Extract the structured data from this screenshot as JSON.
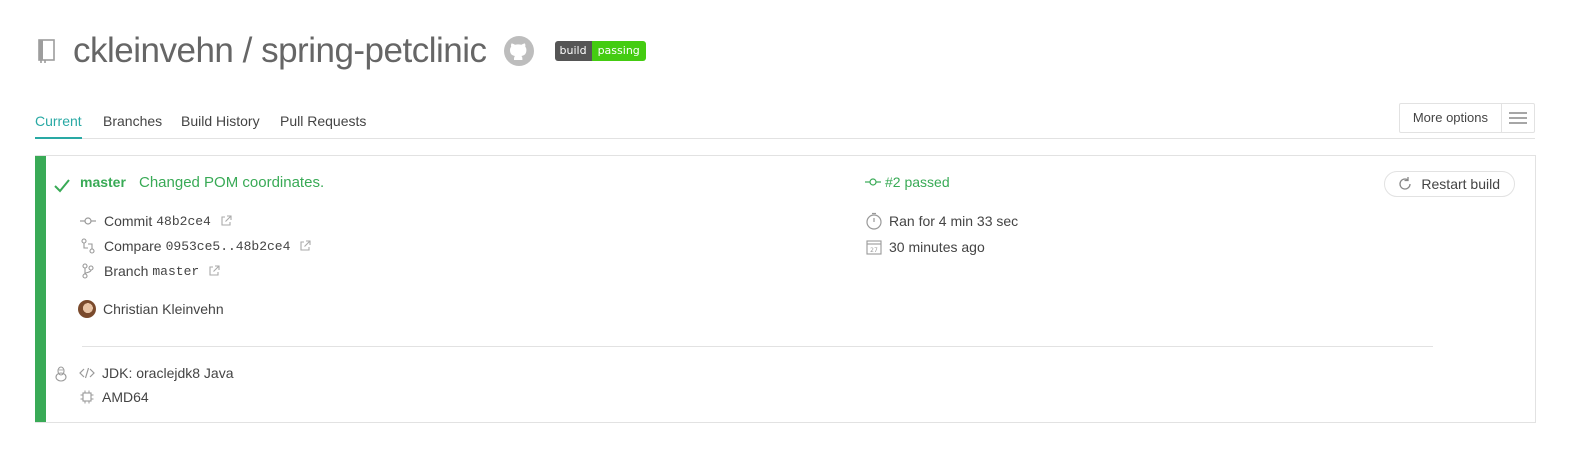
{
  "repo": {
    "owner": "ckleinvehn",
    "separator": " / ",
    "name": "spring-petclinic",
    "badge": {
      "left": "build",
      "right": "passing",
      "color": "#44cc11"
    }
  },
  "tabs": [
    {
      "label": "Current",
      "active": true
    },
    {
      "label": "Branches",
      "active": false
    },
    {
      "label": "Build History",
      "active": false
    },
    {
      "label": "Pull Requests",
      "active": false
    }
  ],
  "more_options": {
    "label": "More options",
    "icon": "hamburger-icon"
  },
  "build": {
    "status_color": "#39aa56",
    "branch": "master",
    "message": "Changed POM coordinates.",
    "number_text": "#2 passed",
    "commit_label": "Commit",
    "commit_sha": "48b2ce4",
    "compare_label": "Compare",
    "compare_range": "0953ce5..48b2ce4",
    "branch_label": "Branch",
    "branch_value": "master",
    "author": "Christian Kleinvehn",
    "duration": "Ran for 4 min 33 sec",
    "finished": "30 minutes ago",
    "restart_label": "Restart build"
  },
  "job": {
    "os_icon": "linux-icon",
    "language": "JDK: oraclejdk8 Java",
    "arch": "AMD64"
  }
}
